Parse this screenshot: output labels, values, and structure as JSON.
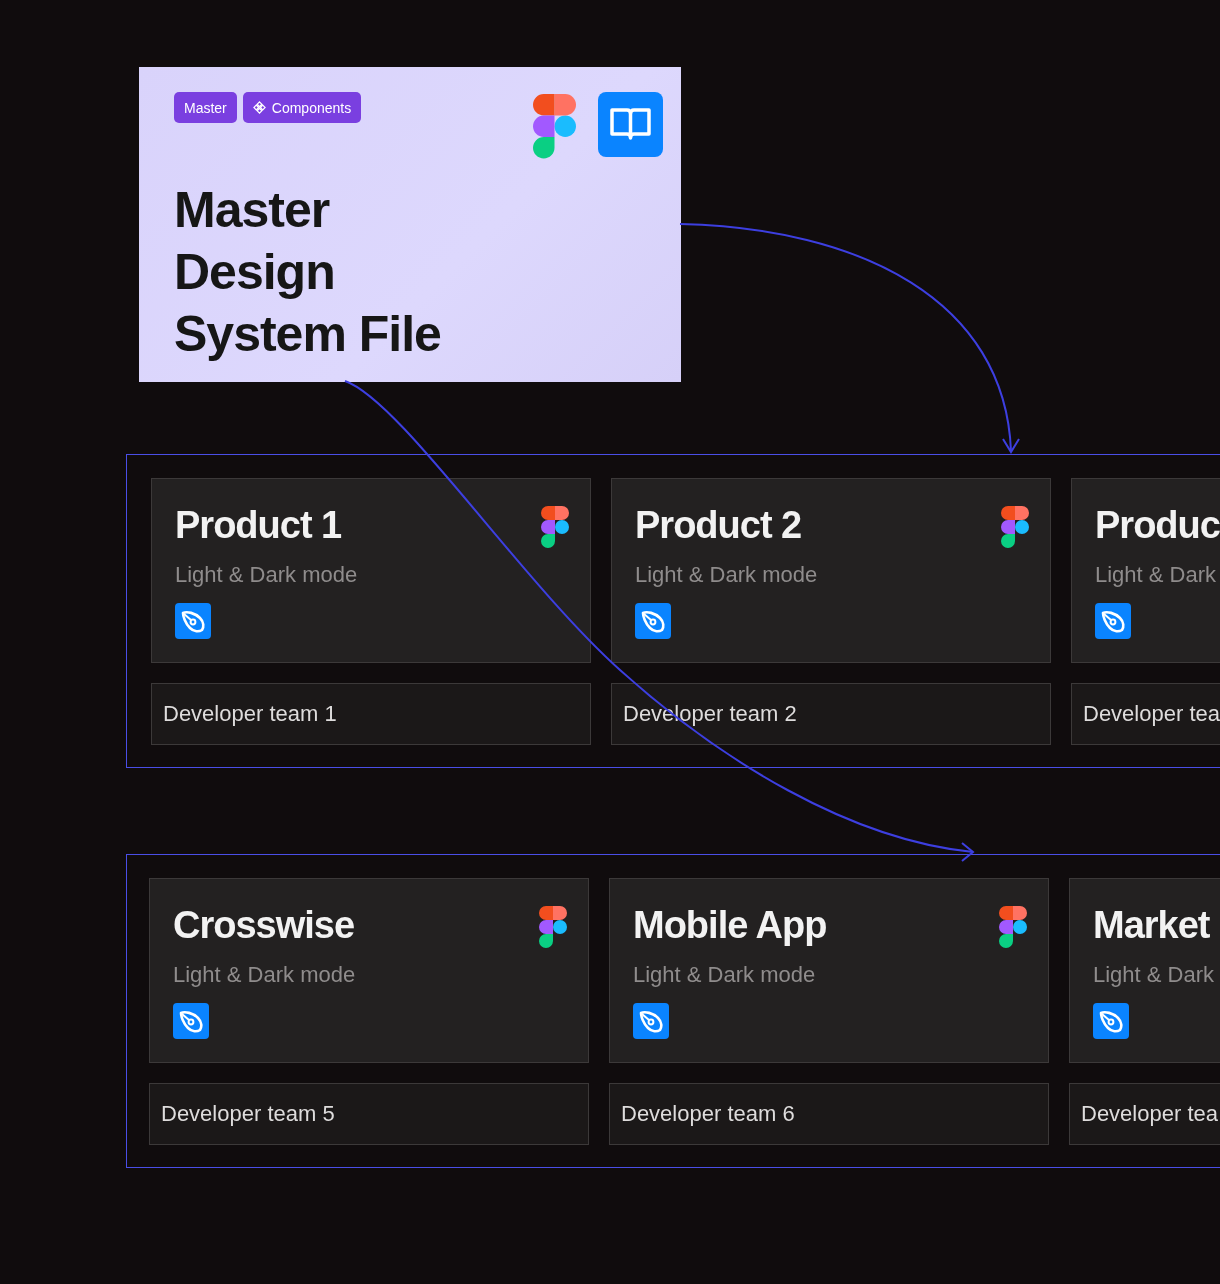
{
  "master_card": {
    "tags": [
      {
        "label": "Master",
        "kind": "plain"
      },
      {
        "label": "Components",
        "kind": "component"
      }
    ],
    "title": "Master Design System File"
  },
  "groups": [
    {
      "products": [
        {
          "title": "Product 1",
          "subtitle": "Light & Dark mode",
          "team": "Developer team 1"
        },
        {
          "title": "Product 2",
          "subtitle": "Light & Dark mode",
          "team": "Developer team 2"
        },
        {
          "title": "Produc",
          "subtitle": "Light & Dark",
          "team": "Developer tea"
        }
      ]
    },
    {
      "products": [
        {
          "title": "Crosswise",
          "subtitle": "Light & Dark mode",
          "team": "Developer team 5"
        },
        {
          "title": "Mobile App",
          "subtitle": "Light & Dark mode",
          "team": "Developer team 6"
        },
        {
          "title": "Market",
          "subtitle": "Light & Dark",
          "team": "Developer tea"
        }
      ]
    }
  ]
}
